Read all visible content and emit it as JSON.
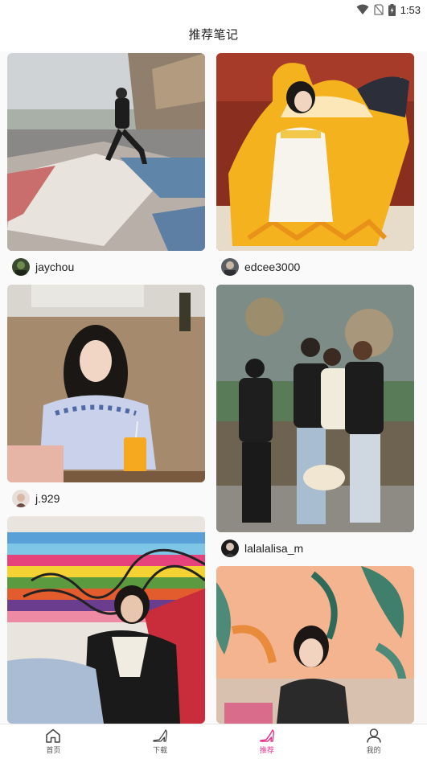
{
  "status_bar": {
    "time": "1:53",
    "icons": [
      "wifi-icon",
      "no-sim-icon",
      "battery-icon"
    ]
  },
  "header": {
    "title": "推荐笔记"
  },
  "feed": {
    "left_column": [
      {
        "username": "jaychou",
        "image": "man-dancing-street-photo"
      },
      {
        "username": "j.929",
        "image": "woman-cafe-photo"
      },
      {
        "username": "",
        "image": "woman-colorful-stairs-photo"
      }
    ],
    "right_column": [
      {
        "username": "edcee3000",
        "image": "child-dinosaur-costume-photo"
      },
      {
        "username": "lalalalisa_m",
        "image": "four-women-museum-photo"
      },
      {
        "username": "",
        "image": "woman-mural-wall-photo"
      }
    ]
  },
  "tab_bar": {
    "tabs": [
      {
        "label": "首页",
        "icon": "home-icon",
        "active": false
      },
      {
        "label": "下载",
        "icon": "heel-shoe-icon",
        "active": false
      },
      {
        "label": "推荐",
        "icon": "heel-shoe-icon",
        "active": true
      },
      {
        "label": "我的",
        "icon": "person-icon",
        "active": false
      }
    ],
    "active_color": "#e8338a"
  }
}
